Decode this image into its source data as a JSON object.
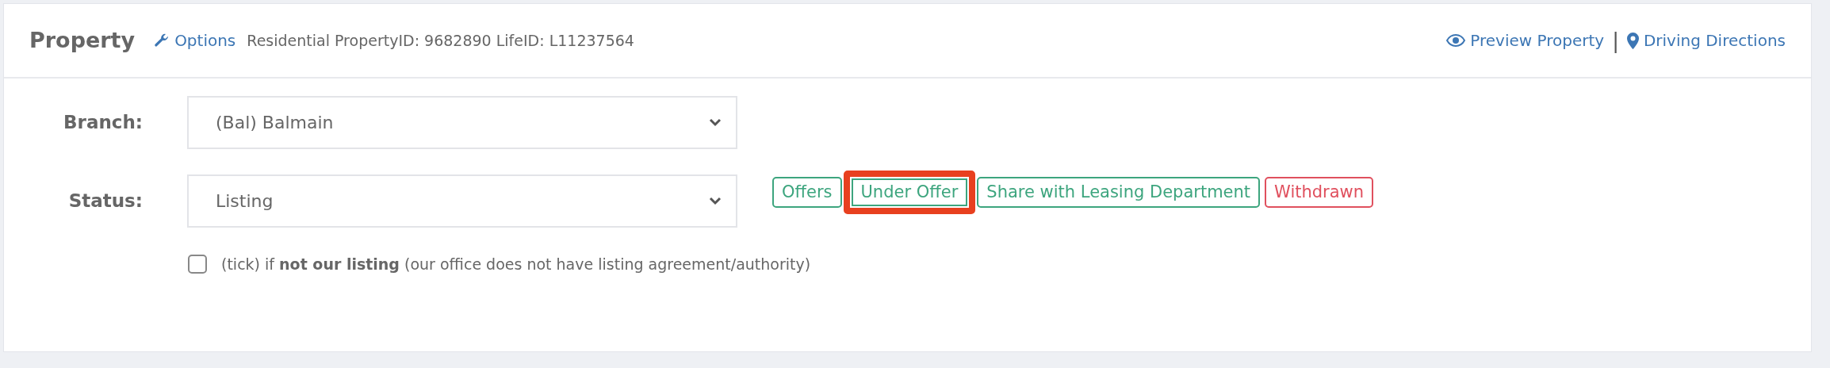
{
  "header": {
    "title": "Property",
    "options_link": "Options",
    "info": "Residential PropertyID: 9682890 LifeID: L11237564",
    "links": [
      {
        "kind": "preview",
        "label": "Preview Property"
      },
      {
        "kind": "directions",
        "label": "Driving Directions"
      }
    ],
    "separator": "|"
  },
  "fields": [
    {
      "label": "Branch:",
      "value": "(Bal) Balmain"
    },
    {
      "label": "Status:",
      "value": "Listing"
    }
  ],
  "status_buttons": [
    {
      "label": "Offers",
      "color": "#3da57e",
      "highlighted": false
    },
    {
      "label": "Under Offer",
      "color": "#3da57e",
      "highlighted": true
    },
    {
      "label": "Share with Leasing Department",
      "color": "#3da57e",
      "highlighted": false
    },
    {
      "label": "Withdrawn",
      "color": "#e0505e",
      "highlighted": false
    }
  ],
  "not_our_listing": {
    "checked": false,
    "text": "(tick) if **not our listing** (our office does not have listing agreement/authority)"
  }
}
